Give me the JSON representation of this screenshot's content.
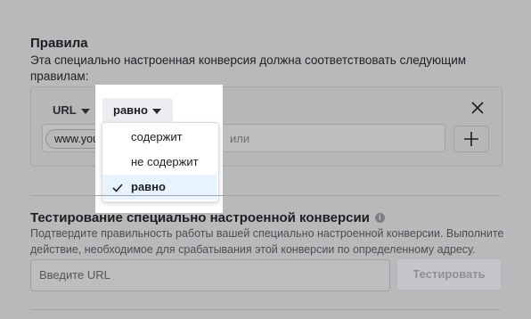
{
  "rules": {
    "title": "Правила",
    "description": "Эта специально настроенная конверсия должна соответствовать следующим правилам:",
    "field_dropdown": "URL",
    "operator_dropdown": "равно",
    "chip_value": "www.yours",
    "input_placeholder_tail": "или",
    "add_icon": "plus-icon",
    "close_icon": "close-icon"
  },
  "operator_menu": {
    "items": [
      {
        "label": "содержит",
        "selected": false
      },
      {
        "label": "не содержит",
        "selected": false
      },
      {
        "label": "равно",
        "selected": true
      }
    ]
  },
  "test": {
    "title": "Тестирование специально настроенной конверсии",
    "description": "Подтвердите правильность работы вашей специально настроенной конверсии. Выполните действие, необходимое для срабатывания этой конверсии по определенному адресу.",
    "input_placeholder": "Введите URL",
    "button_label": "Тестировать"
  }
}
